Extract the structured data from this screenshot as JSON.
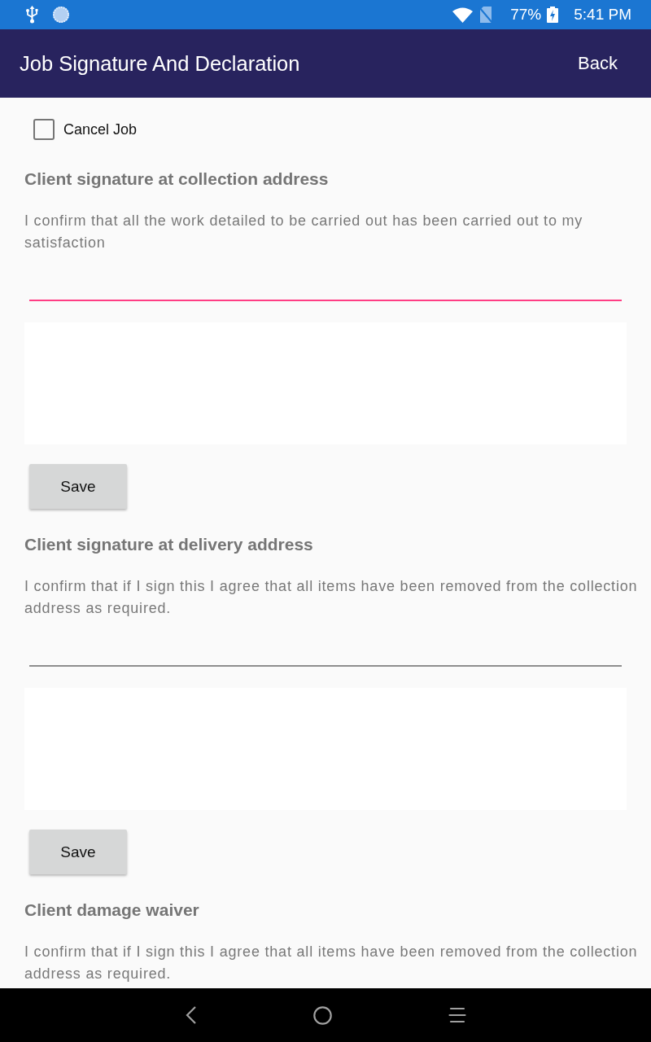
{
  "status_bar": {
    "battery": "77%",
    "time": "5:41 PM"
  },
  "app_bar": {
    "title": "Job Signature And Declaration",
    "back": "Back"
  },
  "cancel_job": {
    "label": "Cancel Job",
    "checked": false
  },
  "sections": [
    {
      "heading": "Client signature at collection address",
      "text": "I confirm that all the work detailed to be carried out has been carried out to my satisfaction",
      "field": {
        "focused": true
      },
      "save": "Save"
    },
    {
      "heading": "Client signature at delivery address",
      "text": "I confirm that if I sign this I agree that all items have been removed from the collection address as required.",
      "field": {
        "focused": false
      },
      "save": "Save"
    },
    {
      "heading": "Client damage waiver",
      "text": "I confirm that if I sign this I agree that all items have been removed from the collection address as required."
    }
  ]
}
